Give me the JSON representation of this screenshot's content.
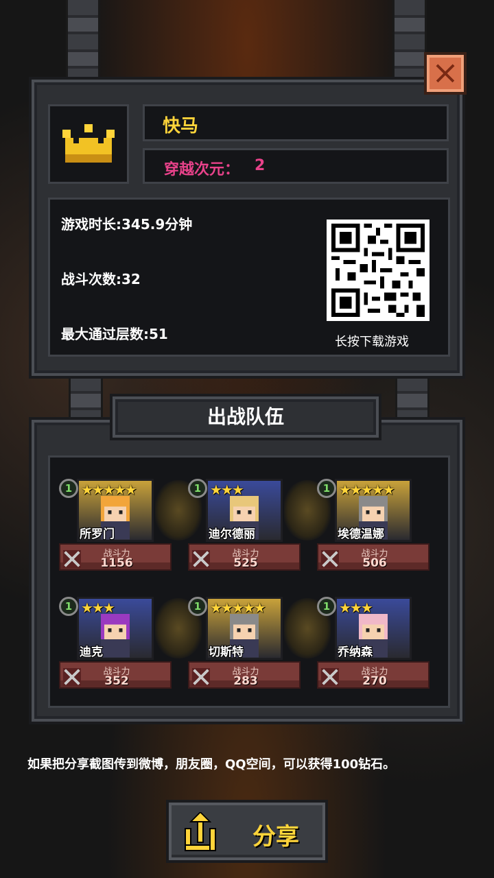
{
  "player": {
    "name": "快马",
    "dimension_label": "穿越次元：",
    "dimension_value": "2"
  },
  "stats": {
    "playtime": "游戏时长:345.9分钟",
    "battles": "战斗次数:32",
    "max_floor": "最大通过层数:51"
  },
  "qr": {
    "caption": "长按下载游戏"
  },
  "team": {
    "title": "出战队伍",
    "power_label": "战斗力",
    "heroes": [
      {
        "name": "所罗门",
        "level": "1",
        "stars": "★★★★★",
        "power": "1156",
        "bg": "#c9a23a",
        "hair": "#f2a53a",
        "icon": "bow"
      },
      {
        "name": "迪尔德丽",
        "level": "1",
        "stars": "★★★",
        "power": "525",
        "bg": "#3a4a9a",
        "hair": "#e8c77a",
        "icon": "sword"
      },
      {
        "name": "埃德温娜",
        "level": "1",
        "stars": "★★★★★",
        "power": "506",
        "bg": "#c9a23a",
        "hair": "#8a8a8a",
        "icon": "staff"
      },
      {
        "name": "迪克",
        "level": "1",
        "stars": "★★★",
        "power": "352",
        "bg": "#3a4a9a",
        "hair": "#9a3ac0",
        "icon": "sword"
      },
      {
        "name": "切斯特",
        "level": "1",
        "stars": "★★★★★",
        "power": "283",
        "bg": "#c9a23a",
        "hair": "#8a8a8a",
        "icon": "bow"
      },
      {
        "name": "乔纳森",
        "level": "1",
        "stars": "★★★",
        "power": "270",
        "bg": "#3a4a9a",
        "hair": "#f0b8c8",
        "icon": "staff"
      }
    ]
  },
  "footer": {
    "notice": "如果把分享截图传到微博，朋友圈，QQ空间，可以获得100钻石。",
    "share_label": "分享"
  },
  "colors": {
    "accent_pink": "#e8428a",
    "gold": "#ffd43a"
  },
  "icons": {
    "close": "close-icon",
    "crown": "crown-icon",
    "share": "share-icon"
  }
}
